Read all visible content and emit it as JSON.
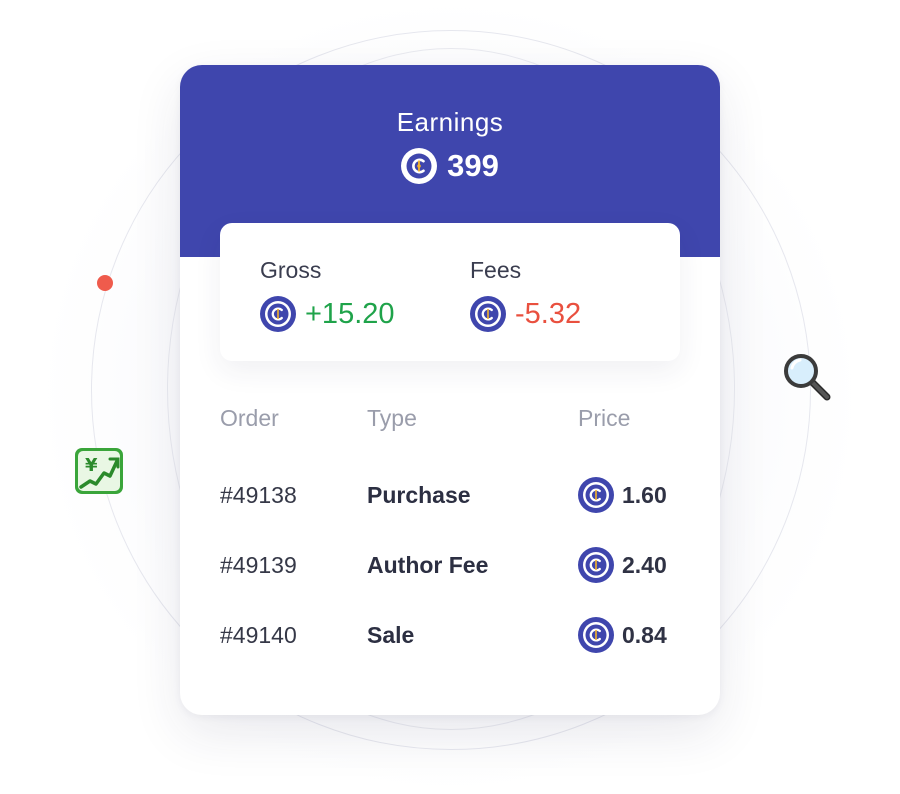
{
  "earnings": {
    "title": "Earnings",
    "value": "399"
  },
  "summary": {
    "gross": {
      "label": "Gross",
      "value": "+15.20"
    },
    "fees": {
      "label": "Fees",
      "value": "-5.32"
    }
  },
  "table": {
    "headers": {
      "order": "Order",
      "type": "Type",
      "price": "Price"
    },
    "rows": [
      {
        "order": "#49138",
        "type": "Purchase",
        "price": "1.60"
      },
      {
        "order": "#49139",
        "type": "Author Fee",
        "price": "2.40"
      },
      {
        "order": "#49140",
        "type": "Sale",
        "price": "0.84"
      }
    ]
  },
  "icons": {
    "coin": "coin-icon",
    "magnifier": "magnifier-icon",
    "chart": "yen-chart-icon",
    "dot": "red-dot"
  },
  "colors": {
    "header_bg": "#3f46ad",
    "coin_bg": "#3f46ad",
    "coin_mark": "#f5b32a",
    "positive": "#1fa34a",
    "negative": "#e9503f",
    "accent_dot": "#ef5b4c"
  }
}
